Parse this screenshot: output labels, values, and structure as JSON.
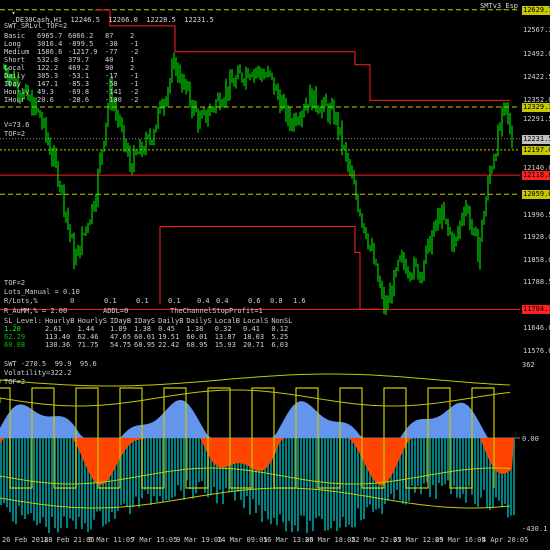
{
  "window": {
    "symbol_title": ".DE30Cash,H1  12246.5  12266.0  12228.5  12231.5",
    "indicator_tag": "SMTv3_Esp"
  },
  "main_panel": {
    "header": "SWT_SRLvl_TOF=2",
    "table": [
      [
        "Basic",
        "6965.7",
        "6066.2",
        "87",
        "2"
      ],
      [
        "Long",
        "3016.4",
        "-899.5",
        "-30",
        "-1"
      ],
      [
        "Medium",
        "1586.6",
        "-1217.9",
        "-77",
        "-2"
      ],
      [
        "Short",
        "532.8",
        "379.7",
        "40",
        "1"
      ],
      [
        "Local",
        "122.2",
        "469.2",
        "90",
        "2"
      ],
      [
        "Daily",
        "305.3",
        "-53.1",
        "-17",
        "-1"
      ],
      [
        "IDay",
        "147.1",
        "-85.3",
        "-58",
        "-1"
      ],
      [
        "Hourly",
        "49.3",
        "-69.8",
        "-141",
        "-2"
      ],
      [
        "IHour",
        "20.6",
        "-20.6",
        "-100",
        "-2"
      ]
    ],
    "v_line": "V=73.6",
    "tof_line": "TOF=2",
    "bottom_lines": {
      "tof": "TOF=2",
      "lots_manual": "Lots_Manual = 0.10",
      "rlots_label": "R/Lots,%",
      "rlots_values": [
        "0",
        "0.1",
        "0.1",
        "0.1",
        "0.4",
        "0.4",
        "0.6",
        "0.8",
        "1.6"
      ],
      "r_aumm": "R_AuMM,% = 2.00",
      "addl": "ADDL=0",
      "stop_profit": "TheChannelStopProfit=1"
    },
    "sl_table": {
      "headers": [
        "SL_Level:",
        "HourlyB",
        "HourlyS",
        "IDayB",
        "IDayS",
        "DailyB",
        "DailyS",
        "LocalB",
        "LocalS",
        "NonSL"
      ],
      "rows": [
        {
          "level": "1.20",
          "values": [
            "2.61",
            "1.44",
            "1.09",
            "1.38",
            "0.45",
            "1.38",
            "0.32",
            "0.41",
            "0.12"
          ]
        },
        {
          "level": "62.29",
          "values": [
            "113.40",
            "62.46",
            "47.65",
            "60.01",
            "19.51",
            "60.01",
            "13.87",
            "18.03",
            "5.25"
          ]
        },
        {
          "level": "60.08",
          "values": [
            "130.36",
            "71.75",
            "54.75",
            "68.95",
            "22.42",
            "68.95",
            "15.93",
            "20.71",
            "6.03"
          ]
        }
      ],
      "level_colors": [
        "#00ff00",
        "#00c000",
        "#00c000"
      ]
    },
    "price_scale": [
      "12629.7",
      "12567.3",
      "12492.0",
      "12422.5",
      "12352.0",
      "12329.3",
      "12291.5",
      "12231.5",
      "12197.0",
      "12140.0",
      "12118.8",
      "12059.6",
      "11996.5",
      "11928.0",
      "11858.0",
      "11788.5",
      "11704.1",
      "11646.0",
      "11576.0"
    ],
    "tagged_prices": [
      {
        "text": "12629.7",
        "color": "#c8c800"
      },
      {
        "text": "12329.3",
        "color": "#c8c800"
      },
      {
        "text": "12231.5",
        "color": "#c0c0c0"
      },
      {
        "text": "12197.0",
        "color": "#c8c800"
      },
      {
        "text": "12118.8",
        "color": "#ff2020"
      },
      {
        "text": "12059.6",
        "color": "#c8c800"
      },
      {
        "text": "11704.1",
        "color": "#ff2020"
      }
    ]
  },
  "sub_panel": {
    "title": "SWT -270.5  99.9  95.6",
    "volatility": "Volatility=322.2",
    "tof": "TOF=2",
    "scale_top": "362",
    "scale_zero": "0.00",
    "scale_bottom": "-430.1"
  },
  "x_axis": [
    "26 Feb 2018",
    "28 Feb 21:05",
    "5 Mar 11:05",
    "7 Mar 15:05",
    "9 Mar 19:05",
    "14 Mar 09:05",
    "16 Mar 13:05",
    "20 Mar 18:05",
    "22 Mar 22:05",
    "27 Mar 12:05",
    "29 Mar 16:05",
    "4 Apr 20:05"
  ],
  "colors": {
    "background": "#000000",
    "candles": "#00ff00",
    "level_yellow": "#c8c800",
    "level_red": "#ff2020",
    "histo_teal": "#008080",
    "area_orange": "#ff4500",
    "area_blue": "#6495ed"
  }
}
